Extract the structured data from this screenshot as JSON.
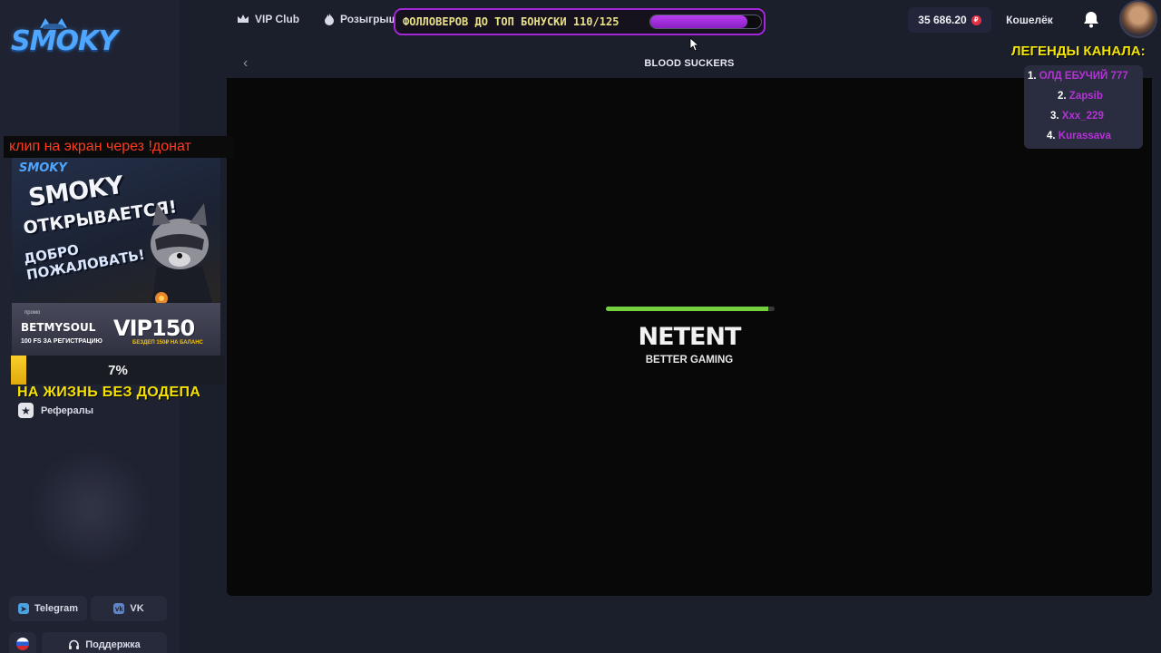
{
  "brand": {
    "logo_text": "SMOKY"
  },
  "topbar": {
    "nav": [
      {
        "label": "VIP Club",
        "icon": "crown-icon"
      },
      {
        "label": "Розыгрыш",
        "icon": "flame-icon"
      }
    ],
    "balance": "35 686.20",
    "currency_symbol": "₽",
    "wallet_label": "Кошелёк"
  },
  "overlay": {
    "followers_text": "ФОЛЛОВЕРОВ ДО ТОП БОНУСКИ 110/125",
    "followers_current": 110,
    "followers_goal": 125,
    "clip_banner": "клип на экран через !донат",
    "promo": {
      "logo": "SMOKY",
      "title": "SMOKY",
      "subtitle": "ОТКРЫВАЕТСЯ!",
      "welcome": "ДОБРО ПОЖАЛОВАТЬ!",
      "code_label": "промо",
      "code": "BETMYSOUL",
      "fs_text": "100 FS ЗА РЕГИСТРАЦИЮ",
      "vip": "VIP150",
      "dep_text": "БЕЗДЕП 150₽ НА БАЛАНС"
    },
    "goal_percent_label": "7%",
    "goal_percent": 7,
    "goal_text": "НА ЖИЗНЬ БЕЗ ДОДЕПА",
    "legends_title": "ЛЕГЕНДЫ КАНАЛА:",
    "legends": [
      {
        "rank": "1.",
        "name": "ОЛД ЕБУЧИЙ 777"
      },
      {
        "rank": "2.",
        "name": "Zapsib"
      },
      {
        "rank": "3.",
        "name": "Xxx_229"
      },
      {
        "rank": "4.",
        "name": "Kurassava"
      }
    ]
  },
  "sidebar": {
    "referrals_label": "Рефералы",
    "social": [
      {
        "label": "Telegram",
        "color": "#4aa3e0"
      },
      {
        "label": "VK",
        "color": "#5f85c9"
      }
    ],
    "support_label": "Поддержка",
    "language": "RU"
  },
  "game": {
    "title": "BLOOD SUCKERS",
    "provider": "NETENT",
    "provider_tagline": "BETTER GAMING",
    "loading_progress": 0.96
  },
  "colors": {
    "accent": "#a326d8",
    "loading": "#74d03d",
    "goal": "#f6c400",
    "legend_name": "#b533d6"
  }
}
